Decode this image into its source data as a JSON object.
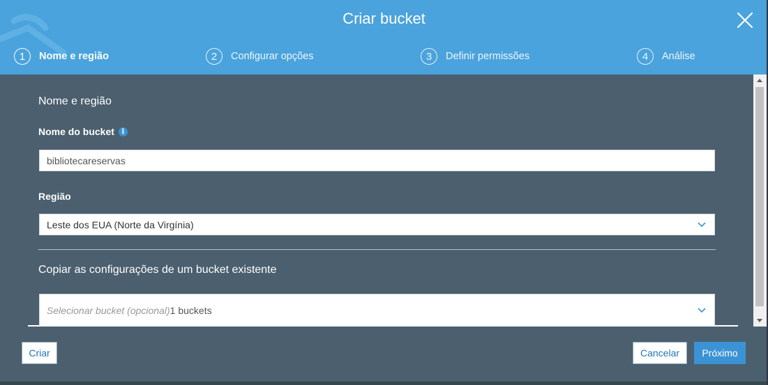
{
  "dialog": {
    "title": "Criar bucket"
  },
  "steps": [
    {
      "number": "1",
      "label": "Nome e região",
      "active": true
    },
    {
      "number": "2",
      "label": "Configurar opções",
      "active": false
    },
    {
      "number": "3",
      "label": "Definir permissões",
      "active": false
    },
    {
      "number": "4",
      "label": "Análise",
      "active": false
    }
  ],
  "form": {
    "section_title": "Nome e região",
    "bucket_name_label": "Nome do bucket",
    "bucket_name_value": "bibliotecareservas",
    "region_label": "Região",
    "region_value": "Leste dos EUA (Norte da Virgínia)",
    "copy_title": "Copiar as configurações de um bucket existente",
    "copy_placeholder": "Selecionar bucket (opcional)",
    "copy_count": "1 buckets"
  },
  "footer": {
    "create_label": "Criar",
    "cancel_label": "Cancelar",
    "next_label": "Próximo"
  },
  "colors": {
    "header": "#4aa3dc",
    "panel": "#4b5f6e",
    "primary_button": "#3b93d6"
  },
  "icons": {
    "close": "close-icon",
    "info": "info-icon",
    "select_arrow": "chevron-down-icon"
  }
}
